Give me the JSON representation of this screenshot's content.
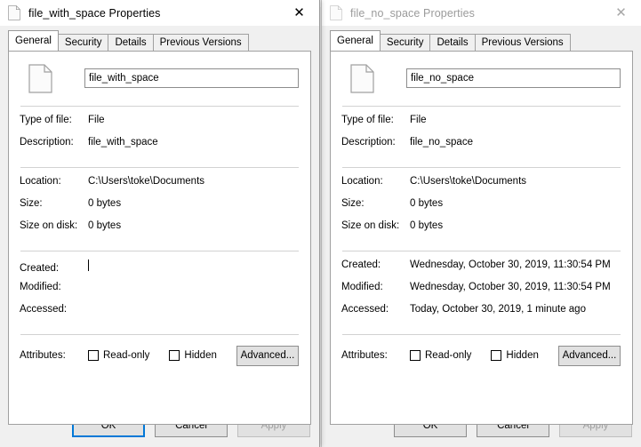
{
  "windows": [
    {
      "id": "left",
      "active": true,
      "title": "file_with_space Properties",
      "title_icon": "file-icon",
      "close_label": "✕",
      "tabs": [
        {
          "label": "General",
          "selected": true
        },
        {
          "label": "Security",
          "selected": false
        },
        {
          "label": "Details",
          "selected": false
        },
        {
          "label": "Previous Versions",
          "selected": false
        }
      ],
      "filename": "file_with_space",
      "info_groups": [
        [
          {
            "label": "Type of file:",
            "value": "File"
          },
          {
            "label": "Description:",
            "value": "file_with_space"
          }
        ],
        [
          {
            "label": "Location:",
            "value": "C:\\Users\\toke\\Documents"
          },
          {
            "label": "Size:",
            "value": "0 bytes"
          },
          {
            "label": "Size on disk:",
            "value": "0 bytes"
          }
        ],
        [
          {
            "label": "Created:",
            "value": "",
            "caret": true
          },
          {
            "label": "Modified:",
            "value": ""
          },
          {
            "label": "Accessed:",
            "value": ""
          }
        ]
      ],
      "attributes": {
        "label": "Attributes:",
        "checkboxes": [
          {
            "label": "Read-only",
            "checked": false
          },
          {
            "label": "Hidden",
            "checked": false
          }
        ],
        "advanced_label": "Advanced..."
      },
      "footer": {
        "ok_label": "OK",
        "ok_focused": true,
        "cancel_label": "Cancel",
        "apply_label": "Apply",
        "apply_disabled": true
      }
    },
    {
      "id": "right",
      "active": false,
      "title": "file_no_space Properties",
      "title_icon": "file-icon",
      "close_label": "✕",
      "tabs": [
        {
          "label": "General",
          "selected": true
        },
        {
          "label": "Security",
          "selected": false
        },
        {
          "label": "Details",
          "selected": false
        },
        {
          "label": "Previous Versions",
          "selected": false
        }
      ],
      "filename": "file_no_space",
      "info_groups": [
        [
          {
            "label": "Type of file:",
            "value": "File"
          },
          {
            "label": "Description:",
            "value": "file_no_space"
          }
        ],
        [
          {
            "label": "Location:",
            "value": "C:\\Users\\toke\\Documents"
          },
          {
            "label": "Size:",
            "value": "0 bytes"
          },
          {
            "label": "Size on disk:",
            "value": "0 bytes"
          }
        ],
        [
          {
            "label": "Created:",
            "value": "Wednesday, October 30, 2019, 11:30:54 PM"
          },
          {
            "label": "Modified:",
            "value": "Wednesday, October 30, 2019, 11:30:54 PM"
          },
          {
            "label": "Accessed:",
            "value": "Today, October 30, 2019, 1 minute ago"
          }
        ]
      ],
      "attributes": {
        "label": "Attributes:",
        "checkboxes": [
          {
            "label": "Read-only",
            "checked": false
          },
          {
            "label": "Hidden",
            "checked": false
          }
        ],
        "advanced_label": "Advanced..."
      },
      "footer": {
        "ok_label": "OK",
        "ok_focused": false,
        "cancel_label": "Cancel",
        "apply_label": "Apply",
        "apply_disabled": true
      }
    }
  ],
  "colors": {
    "focus_blue": "#0078d7",
    "window_bg": "#f0f0f0",
    "panel_bg": "#ffffff",
    "disabled_text": "#a0a0a0",
    "inactive_title_text": "#9b9b9b"
  }
}
